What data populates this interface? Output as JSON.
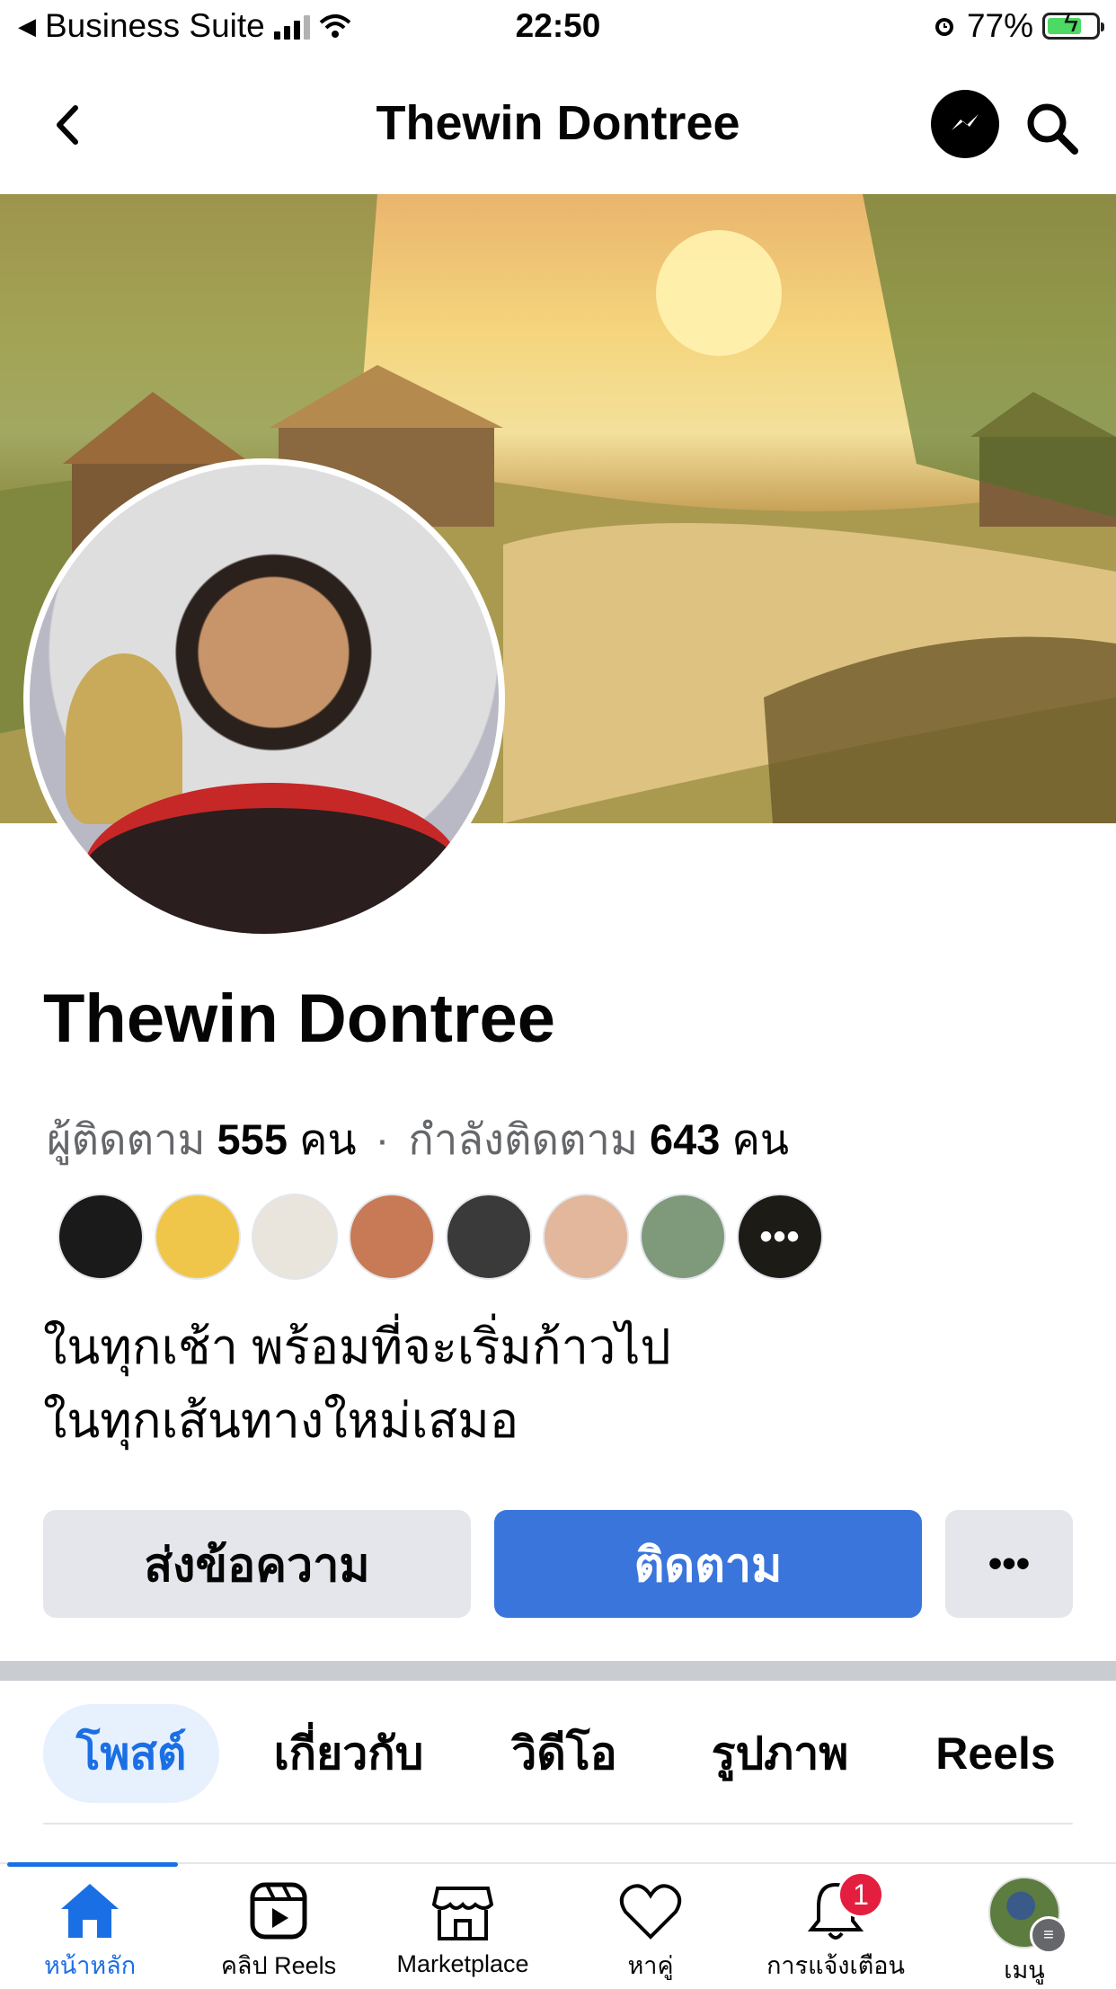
{
  "status_bar": {
    "carrier": "Business Suite",
    "time": "22:50",
    "battery": "77%"
  },
  "header": {
    "title": "Thewin Dontree"
  },
  "profile": {
    "name": "Thewin Dontree",
    "followers_label": "ผู้ติดตาม",
    "followers_count": "555",
    "followers_unit": "คน",
    "separator": "·",
    "following_label": "กำลังติดตาม",
    "following_count": "643",
    "following_unit": "คน",
    "bio_line1": "ในทุกเช้า พร้อมที่จะเริ่มก้าวไป",
    "bio_line2": "ในทุกเส้นทางใหม่เสมอ",
    "friends_more": "•••",
    "friend_colors": [
      "#1a1a1a",
      "#f0c64a",
      "#e9e4dc",
      "#c77a55",
      "#3b3a3a",
      "#e2b79c",
      "#7f9a7a"
    ]
  },
  "actions": {
    "message": "ส่งข้อความ",
    "follow": "ติดตาม",
    "more": "•••"
  },
  "tabs": [
    "โพสต์",
    "เกี่ยวกับ",
    "วิดีโอ",
    "รูปภาพ",
    "Reels"
  ],
  "bottom_nav": {
    "home": "หน้าหลัก",
    "reels": "คลิป Reels",
    "marketplace": "Marketplace",
    "dating": "หาคู่",
    "notifications": "การแจ้งเตือน",
    "notifications_badge": "1",
    "menu": "เมนู"
  },
  "colors": {
    "accent": "#1b6fe4",
    "follow_button": "#3a75dc",
    "badge": "#e41e3f"
  }
}
